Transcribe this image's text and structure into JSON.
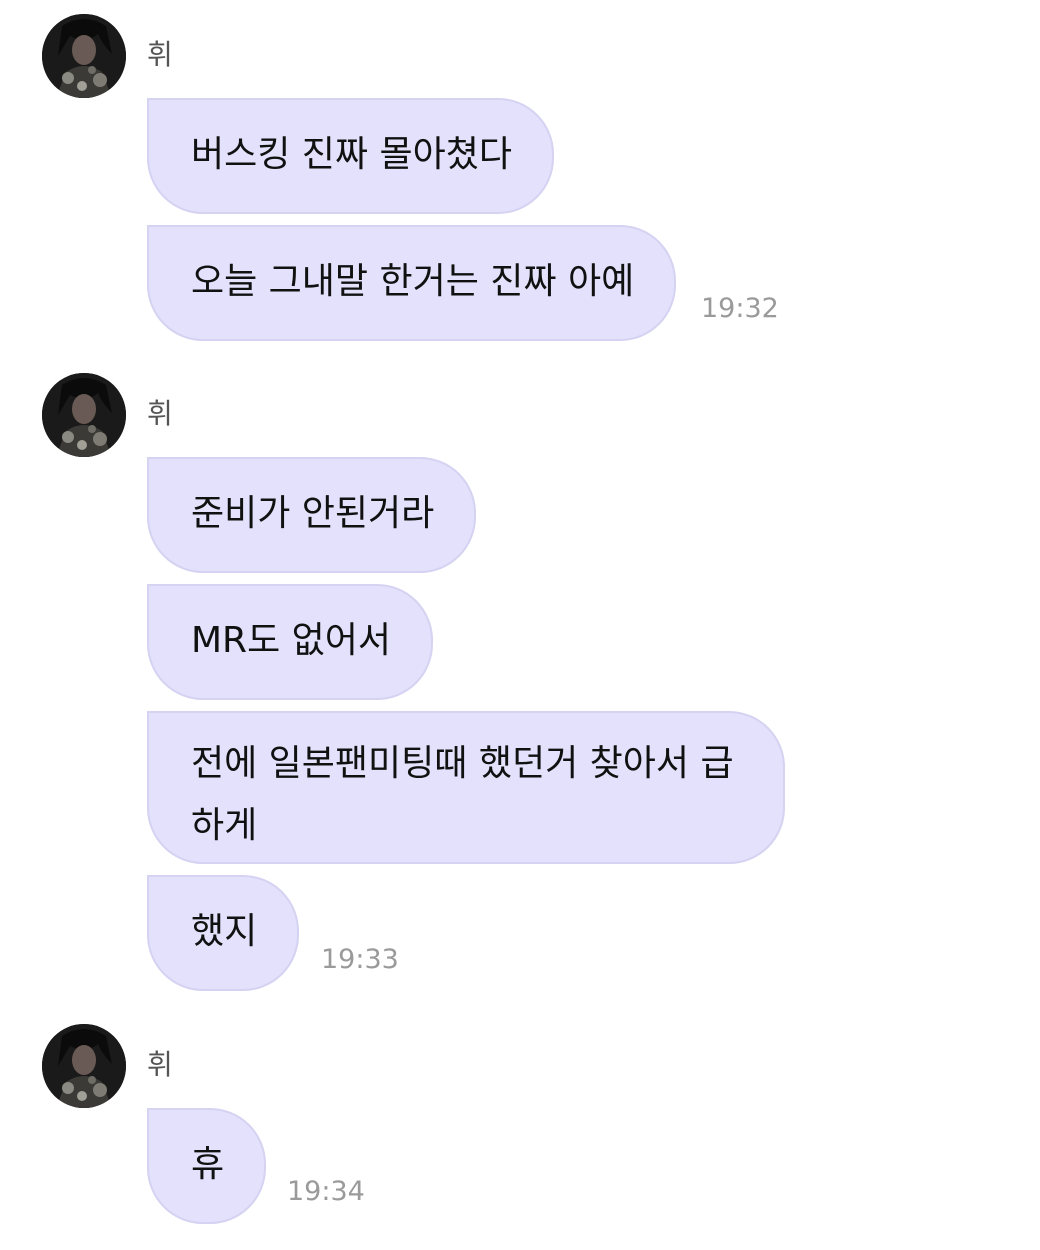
{
  "colors": {
    "bubble_bg": "#e3e1fb",
    "bubble_border": "#d5d2f2",
    "timestamp": "#9a9a9a",
    "sender_name": "#555555"
  },
  "groups": [
    {
      "sender": "휘",
      "avatar_icon": "profile-photo-avatar",
      "messages": [
        "버스킹 진짜 몰아쳤다",
        "오늘 그내말 한거는 진짜 아예"
      ],
      "time": "19:32"
    },
    {
      "sender": "휘",
      "avatar_icon": "profile-photo-avatar",
      "messages": [
        "준비가 안된거라",
        "MR도 없어서",
        "전에 일본팬미팅때 했던거 찾아서 급하게",
        "했지"
      ],
      "time": "19:33"
    },
    {
      "sender": "휘",
      "avatar_icon": "profile-photo-avatar",
      "messages": [
        "휴"
      ],
      "time": "19:34"
    }
  ]
}
